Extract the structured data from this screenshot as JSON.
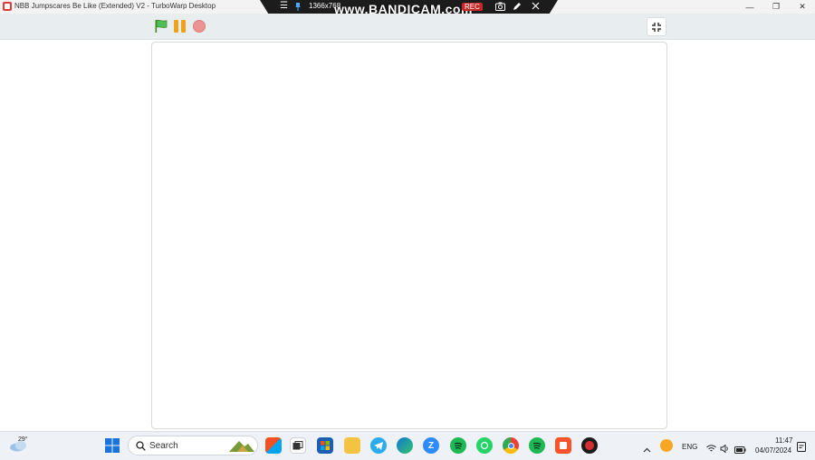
{
  "window": {
    "title": "NBB Jumpscares Be Like (Extended) V2 - TurboWarp Desktop",
    "controls": {
      "minimize": "—",
      "restore": "❐",
      "close": "✕"
    }
  },
  "recorder": {
    "menu_icon": "☰",
    "resolution": "1366x768",
    "brand": "www.BANDICAM.com",
    "rec_label": "REC"
  },
  "toolbar": {
    "green_flag": "green-flag-icon",
    "pause": "pause-icon",
    "stop": "stop-icon",
    "fullscreen": "exit-fullscreen-icon"
  },
  "taskbar": {
    "weather_temp": "29°",
    "search_label": "Search",
    "language": "ENG",
    "time": "11:47",
    "date": "04/07/2024",
    "colors": {
      "telegram": "#2aabee",
      "edge": "#0f78d4",
      "zoom": "#2d8cff",
      "spotify": "#1db954",
      "whatsapp": "#25d366",
      "brave": "#fb542b",
      "bandicam": "#d32f2f"
    }
  }
}
